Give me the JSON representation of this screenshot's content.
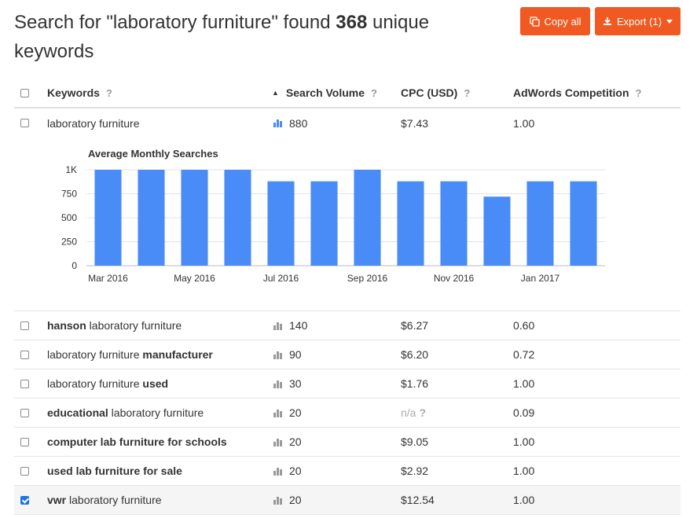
{
  "header": {
    "title_prefix": "Search for \"laboratory furniture\" found ",
    "title_count": "368",
    "title_suffix": " unique keywords",
    "copy_label": "Copy all",
    "export_label": "Export (1)"
  },
  "columns": {
    "keywords": "Keywords",
    "volume": "Search Volume",
    "cpc": "CPC (USD)",
    "competition": "AdWords Competition",
    "help": "?"
  },
  "main_row": {
    "keyword": "laboratory furniture",
    "volume": "880",
    "cpc": "$7.43",
    "competition": "1.00"
  },
  "chart_data": {
    "type": "bar",
    "title": "Average Monthly Searches",
    "categories": [
      "Mar 2016",
      "Apr 2016",
      "May 2016",
      "Jun 2016",
      "Jul 2016",
      "Aug 2016",
      "Sep 2016",
      "Oct 2016",
      "Nov 2016",
      "Dec 2016",
      "Jan 2017",
      "Feb 2017"
    ],
    "x_tick_labels": [
      "Mar 2016",
      "May 2016",
      "Jul 2016",
      "Sep 2016",
      "Nov 2016",
      "Jan 2017"
    ],
    "values": [
      1000,
      1000,
      1000,
      1000,
      880,
      880,
      1000,
      880,
      880,
      720,
      880,
      880
    ],
    "y_ticks": [
      "0",
      "250",
      "500",
      "750",
      "1K"
    ],
    "ylim": [
      0,
      1000
    ],
    "grid": true,
    "color": "#4a8cf7"
  },
  "rows": [
    {
      "kw_pre": "",
      "kw_bold": "hanson",
      "kw_post": " laboratory furniture",
      "volume": "140",
      "cpc": "$6.27",
      "competition": "0.60",
      "checked": false
    },
    {
      "kw_pre": "laboratory furniture ",
      "kw_bold": "manufacturer",
      "kw_post": "",
      "volume": "90",
      "cpc": "$6.20",
      "competition": "0.72",
      "checked": false
    },
    {
      "kw_pre": "laboratory furniture ",
      "kw_bold": "used",
      "kw_post": "",
      "volume": "30",
      "cpc": "$1.76",
      "competition": "1.00",
      "checked": false
    },
    {
      "kw_pre": "",
      "kw_bold": "educational",
      "kw_post": " laboratory furniture",
      "volume": "20",
      "cpc": "n/a",
      "competition": "0.09",
      "checked": false
    },
    {
      "kw_pre": "",
      "kw_bold": "computer lab furniture for schools",
      "kw_post": "",
      "volume": "20",
      "cpc": "$9.05",
      "competition": "1.00",
      "checked": false
    },
    {
      "kw_pre": "",
      "kw_bold": "used lab furniture for sale",
      "kw_post": "",
      "volume": "20",
      "cpc": "$2.92",
      "competition": "1.00",
      "checked": false
    },
    {
      "kw_pre": "",
      "kw_bold": "vwr",
      "kw_post": " laboratory furniture",
      "volume": "20",
      "cpc": "$12.54",
      "competition": "1.00",
      "checked": true
    }
  ],
  "colors": {
    "accent": "#f05a22",
    "bar": "#4a8cf7",
    "icon_active": "#4a8cf7",
    "icon_inactive": "#9a9a9a",
    "checkbox_checked": "#1a73e8"
  }
}
